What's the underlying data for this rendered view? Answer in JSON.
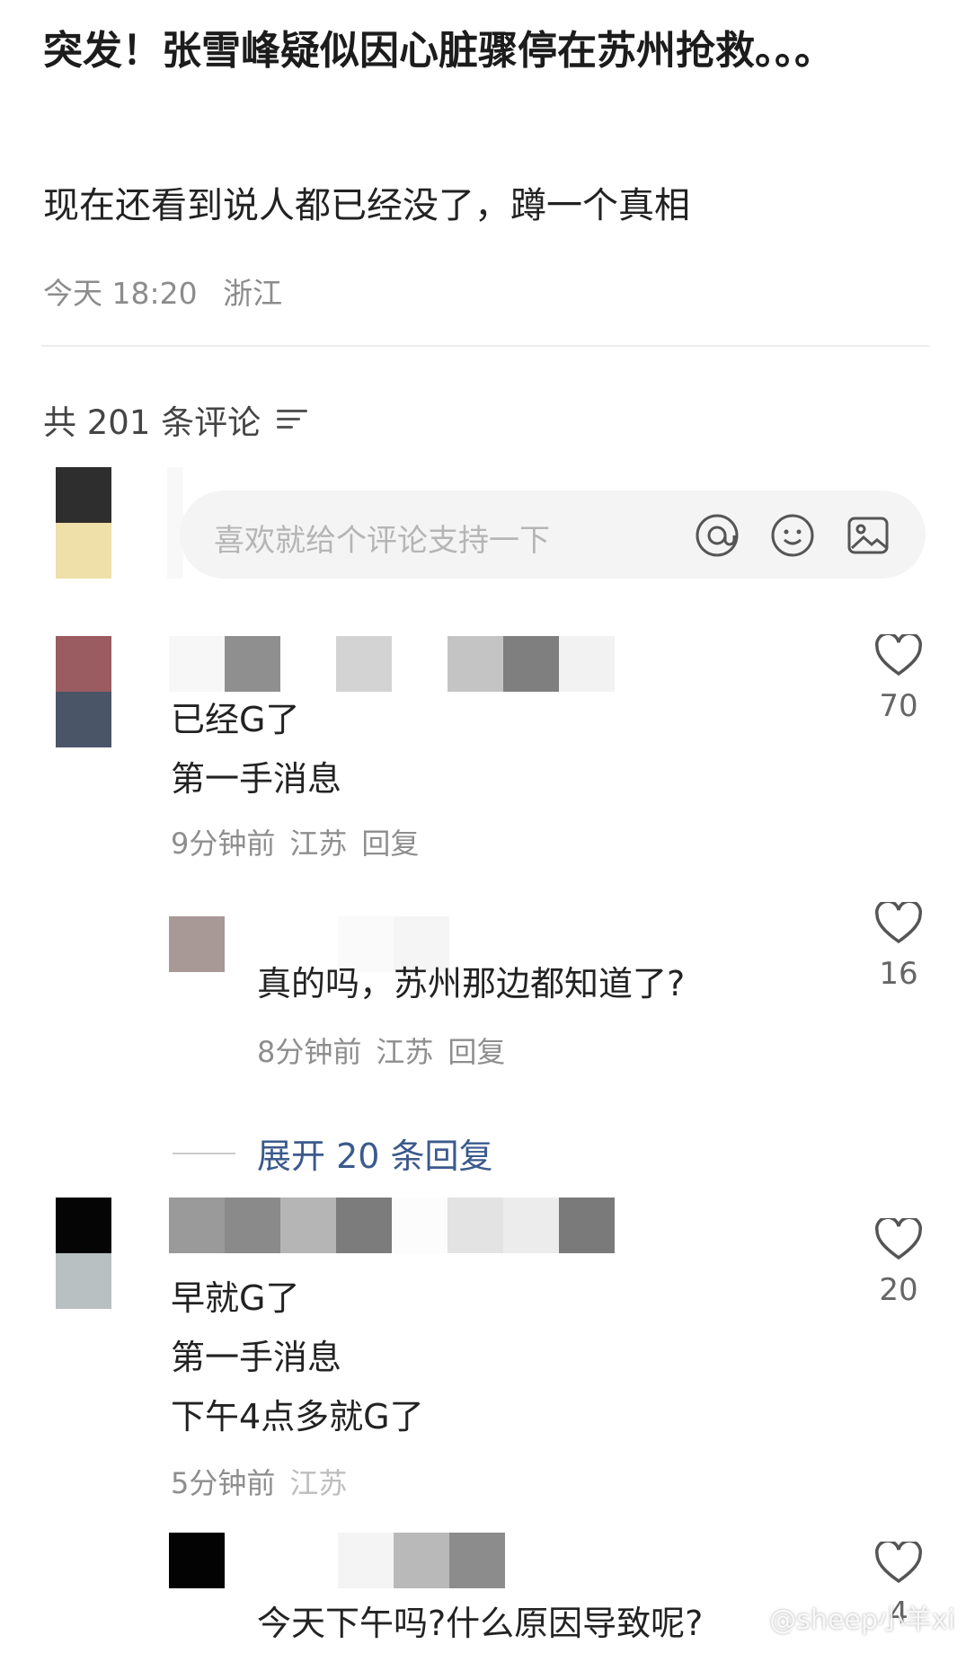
{
  "post": {
    "title": "突发！张雪峰疑似因心脏骤停在苏州抢救。。。",
    "body": "现在还看到说人都已经没了，蹲一个真相",
    "time": "今天 18:20",
    "location": "浙江"
  },
  "comments_header": {
    "count_label": "共 201 条评论",
    "sort_icon": "sort-icon"
  },
  "composer": {
    "placeholder": "喜欢就给个评论支持一下",
    "icons": [
      "at-icon",
      "emoji-icon",
      "image-icon"
    ]
  },
  "comments": [
    {
      "lines": [
        "已经G了",
        "第一手消息"
      ],
      "time": "9分钟前",
      "location": "江苏",
      "reply_label": "回复",
      "likes": "70",
      "avatar_colors": [
        "#9a5c60",
        "#4a5568"
      ],
      "name_colors": [
        "#f7f7f7",
        "#8f8f8f",
        "#ffffff",
        "#d3d3d3",
        "#ffffff",
        "#c4c4c4",
        "#7f7f7f",
        "#f2f2f2"
      ]
    },
    {
      "lines": [
        "真的吗，苏州那边都知道了?"
      ],
      "time": "8分钟前",
      "location": "江苏",
      "reply_label": "回复",
      "likes": "16",
      "avatar_colors": [
        "#a89896"
      ],
      "name_colors": [
        "#ffffff",
        "#fafafa",
        "#f5f5f5",
        "#ffffff"
      ]
    },
    {
      "lines": [
        "早就G了",
        "第一手消息",
        "下午4点多就G了"
      ],
      "time": "5分钟前",
      "location": "江苏",
      "likes": "20",
      "avatar_colors": [
        "#050505",
        "#b9c0c2"
      ],
      "name_colors": [
        "#9a9a9a",
        "#8a8a8a",
        "#b5b5b5",
        "#7c7c7c",
        "#fcfcfc",
        "#e3e3e3",
        "#ececec",
        "#7a7a7a"
      ]
    },
    {
      "lines": [
        "今天下午吗?什么原因导致呢?"
      ],
      "likes": "4",
      "avatar_colors": [
        "#030303"
      ],
      "name_colors": [
        "#ffffff",
        "#f4f4f4",
        "#b9b9b9",
        "#8c8c8c"
      ]
    }
  ],
  "expand_label": "展开 20 条回复",
  "watermark": "@sheep小羊xi"
}
